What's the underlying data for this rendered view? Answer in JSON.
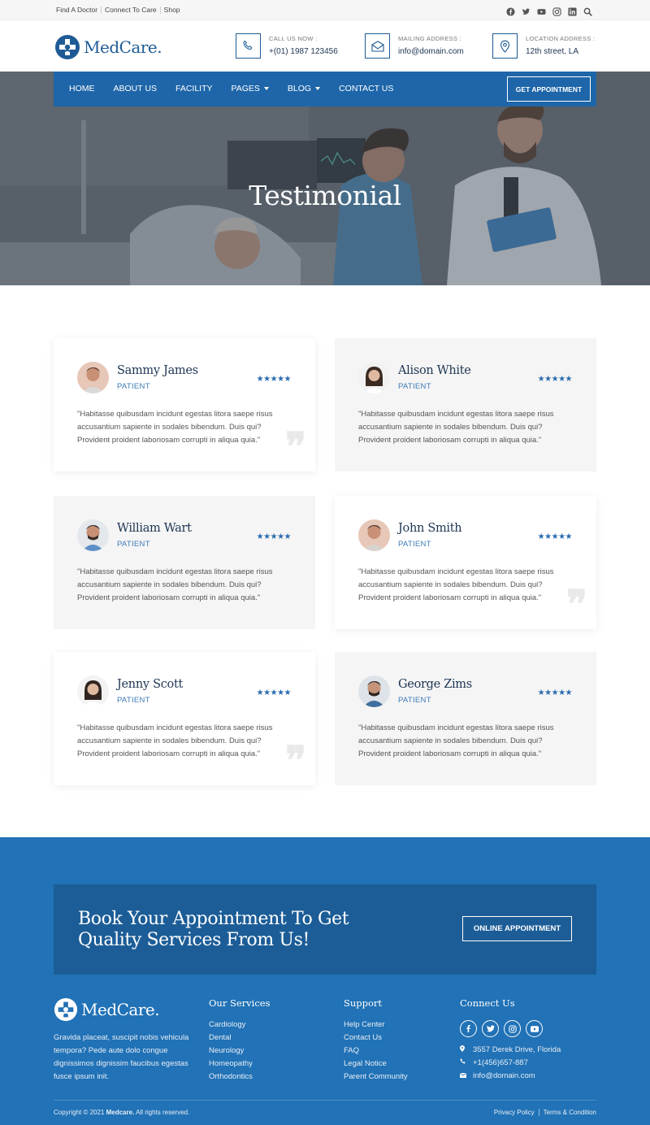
{
  "topbar": {
    "links": [
      "Find A Doctor",
      "Connect To Care",
      "Shop"
    ],
    "icons": [
      "facebook-icon",
      "twitter-icon",
      "youtube-icon",
      "instagram-icon",
      "linkedin-icon",
      "search-icon"
    ]
  },
  "header": {
    "brand": "MedCare.",
    "call_label": "CALL US NOW :",
    "call_value": "+(01) 1987 123456",
    "mail_label": "MAILING ADDRESS :",
    "mail_value": "info@domain.com",
    "location_label": "LOCATION ADDRESS :",
    "location_value": "12th street, LA"
  },
  "nav": {
    "items": [
      "HOME",
      "ABOUT US",
      "FACILITY",
      "PAGES",
      "BLOG",
      "CONTACT US"
    ],
    "cta": "GET APPOINTMENT"
  },
  "hero": {
    "title": "Testimonial"
  },
  "testimonials": [
    {
      "name": "Sammy James",
      "role": "PATIENT",
      "stars": "★★★★★",
      "rating": 5,
      "quote": "\"Habitasse quibusdam incidunt egestas litora saepe risus accusantium sapiente in sodales bibendum. Duis qui? Provident proident laboriosam corrupti in aliqua quia.\""
    },
    {
      "name": "Alison White",
      "role": "PATIENT",
      "stars": "★★★★★",
      "rating": 5,
      "quote": "\"Habitasse quibusdam incidunt egestas litora saepe risus accusantium sapiente in sodales bibendum. Duis qui? Provident proident laboriosam corrupti in aliqua quia.\""
    },
    {
      "name": "William Wart",
      "role": "PATIENT",
      "stars": "★★★★★",
      "rating": 5,
      "quote": "\"Habitasse quibusdam incidunt egestas litora saepe risus accusantium sapiente in sodales bibendum. Duis qui? Provident proident laboriosam corrupti in aliqua quia.\""
    },
    {
      "name": "John Smith",
      "role": "PATIENT",
      "stars": "★★★★★",
      "rating": 5,
      "quote": "\"Habitasse quibusdam incidunt egestas litora saepe risus accusantium sapiente in sodales bibendum. Duis qui? Provident proident laboriosam corrupti in aliqua quia.\""
    },
    {
      "name": "Jenny Scott",
      "role": "PATIENT",
      "stars": "★★★★★",
      "rating": 5,
      "quote": "\"Habitasse quibusdam incidunt egestas litora saepe risus accusantium sapiente in sodales bibendum. Duis qui? Provident proident laboriosam corrupti in aliqua quia.\""
    },
    {
      "name": "George Zims",
      "role": "PATIENT",
      "stars": "★★★★★",
      "rating": 5,
      "quote": "\"Habitasse quibusdam incidunt egestas litora saepe risus accusantium sapiente in sodales bibendum. Duis qui? Provident proident laboriosam corrupti in aliqua quia.\""
    }
  ],
  "cta": {
    "title_line1": "Book Your Appointment To Get",
    "title_line2": "Quality Services From Us!",
    "button": "ONLINE APPOINTMENT"
  },
  "footer": {
    "brand": "MedCare.",
    "about": "Gravida placeat, suscipit nobis vehicula tempora? Pede aute dolo congue dignissimos dignissim faucibus egestas fusce ipsum init.",
    "services_title": "Our Services",
    "services": [
      "Cardiology",
      "Dental",
      "Neurology",
      "Homeopathy",
      "Orthodontics"
    ],
    "support_title": "Support",
    "support": [
      "Help Center",
      "Contact Us",
      "FAQ",
      "Legal Notice",
      "Parent Community"
    ],
    "connect_title": "Connect Us",
    "address": "3557 Derek Drive, Florida",
    "phone": "+1(456)657-887",
    "email": "info@domain.com",
    "copyright_prefix": "Copyright © 2021 ",
    "copyright_brand": "Medcare.",
    "copyright_suffix": " All rights reserved.",
    "privacy": "Privacy Policy",
    "terms": "Terms & Condition"
  },
  "colors": {
    "primary": "#1e66a9",
    "dark_navy": "#1d3553",
    "footer_bg": "#2172b6",
    "cta_bg": "#1c5d97"
  }
}
